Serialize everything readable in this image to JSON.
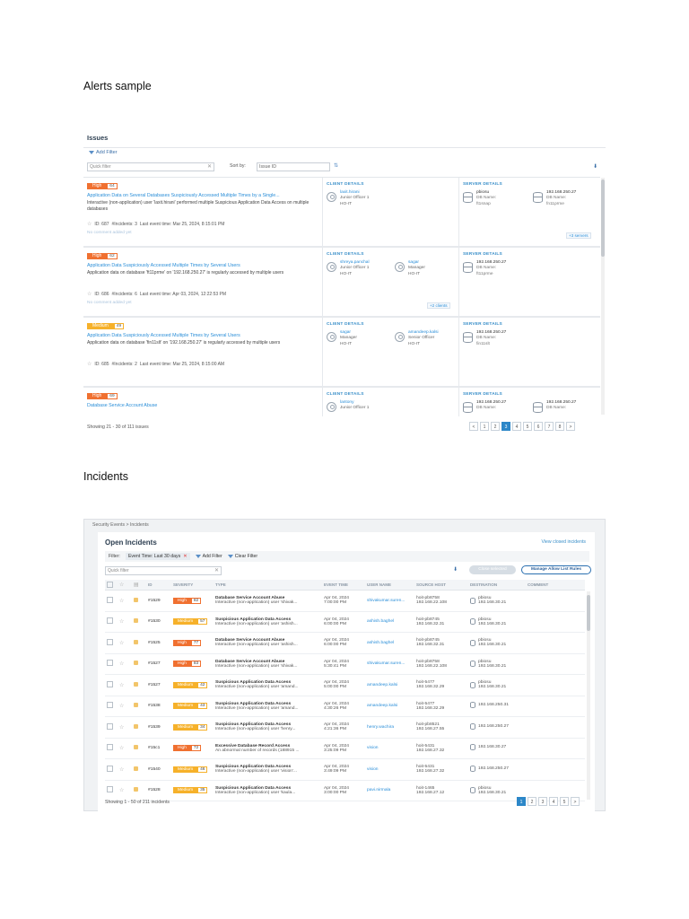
{
  "headings": {
    "alerts": "Alerts sample",
    "incidents": "Incidents"
  },
  "issues": {
    "title": "Issues",
    "add_filter": "Add Filter",
    "quick_filter_placeholder": "Quick filter",
    "sort_label": "Sort by:",
    "sort_value": "Issue ID",
    "client_details": "CLIENT DETAILS",
    "server_details": "SERVER DETAILS",
    "footer": "Showing 21 - 30 of 111 issues",
    "pages": [
      "<",
      "1",
      "2",
      "3",
      "4",
      "5",
      "6",
      "7",
      "8",
      ">"
    ],
    "active_page": "3",
    "items": [
      {
        "sev": "High",
        "score": "64",
        "level": "high",
        "title": "Application Data on Several Databases Suspiciously Accessed Multiple Times by a Single...",
        "desc": "Interactive (non-application) user 'laxit.hirani' performed multiple Suspicious Application Data Access on multiple databases",
        "id": "ID: 687",
        "incidents": "#Incidents: 3",
        "last": "Last event time: Mar 25, 2024, 8:15:01 PM",
        "no_comment": "No comment added yet",
        "clients": [
          {
            "name": "laxit.hirani",
            "role": "Junior Officer 1",
            "dept": "HO-IT"
          }
        ],
        "servers": [
          {
            "ip": "pbiosu",
            "db_label": "DB Name:",
            "db": "ft1snap"
          },
          {
            "ip": "192.168.250.27",
            "db_label": "DB Name:",
            "db": "fn11prme"
          }
        ],
        "more": "+3 servers"
      },
      {
        "sev": "High",
        "score": "62",
        "level": "high",
        "title": "Application Data Suspiciously Accessed Multiple Times by Several Users",
        "desc": "Application data on database 'ft11prme' on '192.168.250.27' is regularly accessed by multiple users",
        "id": "ID: 686",
        "incidents": "#Incidents: 6",
        "last": "Last event time: Apr 03, 2024, 12:22:53 PM",
        "no_comment": "No comment added yet",
        "clients": [
          {
            "name": "shreya.panchal",
            "role": "Junior Officer 1",
            "dept": "HO-IT"
          },
          {
            "name": "sagar",
            "role": "Manager",
            "dept": "HO-IT"
          }
        ],
        "servers": [
          {
            "ip": "192.168.250.27",
            "db_label": "DB Name:",
            "db": "ft11prme"
          }
        ],
        "more": "+2 clients"
      },
      {
        "sev": "Medium",
        "score": "49",
        "level": "medium",
        "title": "Application Data Suspiciously Accessed Multiple Times by Several Users",
        "desc": "Application data on database 'fin11slt' on '192.168.250.27' is regularly accessed by multiple users",
        "id": "ID: 685",
        "incidents": "#Incidents: 2",
        "last": "Last event time: Mar 25, 2024, 8:15:00 AM",
        "no_comment": "",
        "clients": [
          {
            "name": "sagar",
            "role": "Manager",
            "dept": "HO-IT"
          },
          {
            "name": "amandeep.kalsi",
            "role": "Senior Officer",
            "dept": "HO-IT"
          }
        ],
        "servers": [
          {
            "ip": "192.168.250.27",
            "db_label": "DB Name:",
            "db": "fin11slt"
          }
        ],
        "more": ""
      },
      {
        "sev": "High",
        "score": "69",
        "level": "high",
        "title": "Database Service Account Abuse",
        "desc": "",
        "id": "",
        "incidents": "",
        "last": "",
        "no_comment": "",
        "clients": [
          {
            "name": "lantony",
            "role": "Junior Officer 1",
            "dept": ""
          }
        ],
        "servers": [
          {
            "ip": "192.168.250.27",
            "db_label": "DB Name:",
            "db": ""
          },
          {
            "ip": "192.168.250.27",
            "db_label": "DB Name:",
            "db": ""
          }
        ],
        "more": ""
      }
    ]
  },
  "incidents": {
    "breadcrumb": "Security Events > Incidents",
    "title": "Open Incidents",
    "view_closed": "View closed incidents",
    "filter_label": "Filter:",
    "filter_chip": "Event Time: Last 30 days",
    "add_filter": "Add Filter",
    "clear_filter": "Clear Filter",
    "quick_filter_placeholder": "Quick filter",
    "close_selected": "Close selected",
    "manage_allow": "Manage Allow List Rules",
    "columns": [
      "",
      "",
      "",
      "ID",
      "SEVERITY",
      "TYPE",
      "EVENT TIME",
      "USER NAME",
      "SOURCE HOST",
      "DESTINATION",
      "COMMENT"
    ],
    "footer": "Showing 1 - 50 of 211 incidents",
    "pages": [
      "1",
      "2",
      "3",
      "4",
      "5",
      ">"
    ],
    "active_page": "1",
    "rows": [
      {
        "id": "#1529",
        "sev": "High",
        "score": "82",
        "level": "high",
        "type": "Database Service Account Abuse",
        "desc": "Interactive (non-application) user 'shivak...",
        "date": "Apr 04, 2024",
        "time": "7:00:00 PM",
        "user": "shivakumar.suren...",
        "host": "hoit-pb8758",
        "host_ip": "192.168.22.108",
        "dest": "pbiosu",
        "dest_ip": "192.168.30.21"
      },
      {
        "id": "#1530",
        "sev": "Medium",
        "score": "57",
        "level": "medium",
        "type": "Suspicious Application Data Access",
        "desc": "Interactive (non-application) user 'ashish...",
        "date": "Apr 04, 2024",
        "time": "6:00:00 PM",
        "user": "ashish.baghel",
        "host": "hoit-pb8745",
        "host_ip": "192.168.32.31",
        "dest": "pbiosu",
        "dest_ip": "192.168.30.21"
      },
      {
        "id": "#1525",
        "sev": "High",
        "score": "77",
        "level": "high",
        "type": "Database Service Account Abuse",
        "desc": "Interactive (non-application) user 'ashish...",
        "date": "Apr 04, 2024",
        "time": "6:00:00 PM",
        "user": "ashish.baghel",
        "host": "hoit-pb8745",
        "host_ip": "192.168.32.31",
        "dest": "pbiosu",
        "dest_ip": "192.168.30.21"
      },
      {
        "id": "#1527",
        "sev": "High",
        "score": "83",
        "level": "high",
        "type": "Database Service Account Abuse",
        "desc": "Interactive (non-application) user 'shivak...",
        "date": "Apr 04, 2024",
        "time": "5:30:41 PM",
        "user": "shivakumar.suren...",
        "host": "hoit-pb8758",
        "host_ip": "192.168.22.108",
        "dest": "pbiosu",
        "dest_ip": "192.168.30.21"
      },
      {
        "id": "#1527",
        "sev": "Medium",
        "score": "42",
        "level": "medium",
        "type": "Suspicious Application Data Access",
        "desc": "Interactive (non-application) user 'amand...",
        "date": "Apr 04, 2024",
        "time": "5:00:00 PM",
        "user": "amandeep.kalsi",
        "host": "hoit-5477",
        "host_ip": "192.168.32.29",
        "dest": "pbiosu",
        "dest_ip": "192.168.30.21"
      },
      {
        "id": "#1538",
        "sev": "Medium",
        "score": "43",
        "level": "medium",
        "type": "Suspicious Application Data Access",
        "desc": "Interactive (non-application) user 'amand...",
        "date": "Apr 04, 2024",
        "time": "4:30:26 PM",
        "user": "amandeep.kalsi",
        "host": "hoit-5477",
        "host_ip": "192.168.32.29",
        "dest": "192.168.250.31",
        "dest_ip": ""
      },
      {
        "id": "#1539",
        "sev": "Medium",
        "score": "34",
        "level": "medium",
        "type": "Suspicious Application Data Access",
        "desc": "Interactive (non-application) user 'henry...",
        "date": "Apr 04, 2024",
        "time": "4:21:36 PM",
        "user": "henry.wachira",
        "host": "hoit-pb8521",
        "host_ip": "192.168.27.55",
        "dest": "192.168.250.27",
        "dest_ip": ""
      },
      {
        "id": "#15c1",
        "sev": "High",
        "score": "72",
        "level": "high",
        "type": "Excessive Database Record Access",
        "desc": "An abnormal number of records (188915 ...",
        "date": "Apr 04, 2024",
        "time": "3:25:09 PM",
        "user": "vision",
        "host": "hoit-5431",
        "host_ip": "192.168.27.32",
        "dest": "192.168.30.27",
        "dest_ip": ""
      },
      {
        "id": "#1540",
        "sev": "Medium",
        "score": "46",
        "level": "medium",
        "type": "Suspicious Application Data Access",
        "desc": "Interactive (non-application) user 'vision'...",
        "date": "Apr 04, 2024",
        "time": "3:49:09 PM",
        "user": "vision",
        "host": "hoit-5431",
        "host_ip": "192.168.27.32",
        "dest": "192.168.250.27",
        "dest_ip": ""
      },
      {
        "id": "#1528",
        "sev": "Medium",
        "score": "35",
        "level": "medium",
        "type": "Suspicious Application Data Access",
        "desc": "Interactive (non-application) user 'kaula...",
        "date": "Apr 04, 2024",
        "time": "3:00:00 PM",
        "user": "pavi.nirmala",
        "host": "hoit-1465",
        "host_ip": "192.168.27.12",
        "dest": "pbiosu",
        "dest_ip": "192.168.30.21"
      }
    ]
  }
}
